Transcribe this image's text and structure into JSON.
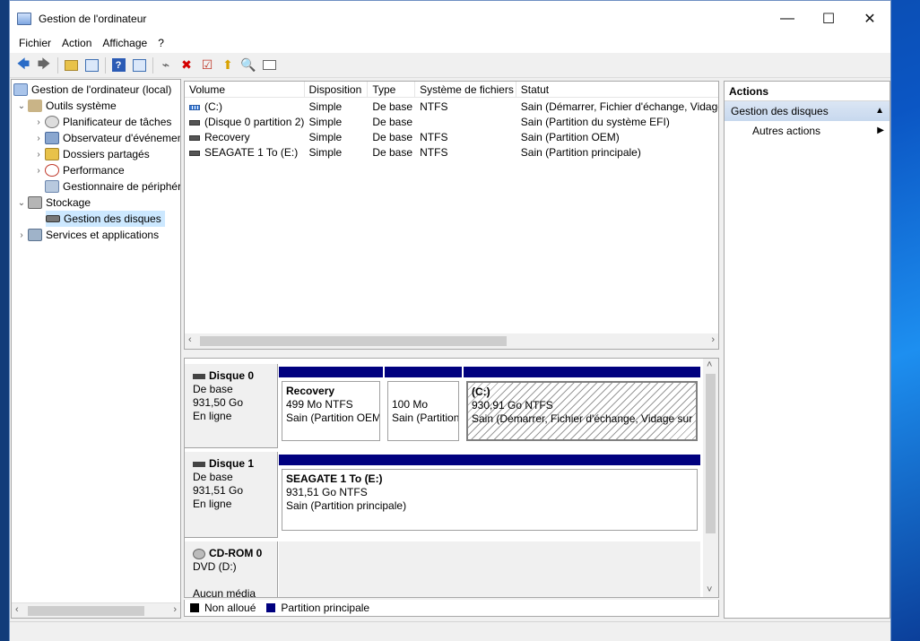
{
  "window": {
    "title": "Gestion de l'ordinateur",
    "controls": {
      "minimize": "—",
      "maximize": "☐",
      "close": "✕"
    }
  },
  "menu": [
    "Fichier",
    "Action",
    "Affichage",
    "?"
  ],
  "tree": {
    "root": "Gestion de l'ordinateur (local)",
    "items": [
      {
        "label": "Outils système",
        "level": 1,
        "expander": "⌄"
      },
      {
        "label": "Planificateur de tâches",
        "level": 2,
        "expander": "›"
      },
      {
        "label": "Observateur d'événements",
        "level": 2,
        "expander": "›"
      },
      {
        "label": "Dossiers partagés",
        "level": 2,
        "expander": "›"
      },
      {
        "label": "Performance",
        "level": 2,
        "expander": "›"
      },
      {
        "label": "Gestionnaire de périphériques",
        "level": 2,
        "expander": ""
      },
      {
        "label": "Stockage",
        "level": 1,
        "expander": "⌄"
      },
      {
        "label": "Gestion des disques",
        "level": 2,
        "expander": ""
      },
      {
        "label": "Services et applications",
        "level": 1,
        "expander": "›"
      }
    ]
  },
  "volumes": {
    "headers": [
      "Volume",
      "Disposition",
      "Type",
      "Système de fichiers",
      "Statut"
    ],
    "rows": [
      [
        "(C:)",
        "Simple",
        "De base",
        "NTFS",
        "Sain (Démarrer, Fichier d'échange, Vidage"
      ],
      [
        "(Disque 0 partition 2)",
        "Simple",
        "De base",
        "",
        "Sain (Partition du système EFI)"
      ],
      [
        "Recovery",
        "Simple",
        "De base",
        "NTFS",
        "Sain (Partition OEM)"
      ],
      [
        "SEAGATE 1 To (E:)",
        "Simple",
        "De base",
        "NTFS",
        "Sain (Partition principale)"
      ]
    ]
  },
  "disks": [
    {
      "name": "Disque 0",
      "type": "De base",
      "size": "931,50 Go",
      "state": "En ligne",
      "partitions": [
        {
          "name": "Recovery",
          "size": "499 Mo NTFS",
          "status": "Sain (Partition OEM)"
        },
        {
          "name": "",
          "size": "100 Mo",
          "status": "Sain (Partition du système EFI)"
        },
        {
          "name": "(C:)",
          "size": "930,91 Go NTFS",
          "status": "Sain (Démarrer, Fichier d'échange, Vidage sur incident)"
        }
      ]
    },
    {
      "name": "Disque 1",
      "type": "De base",
      "size": "931,51 Go",
      "state": "En ligne",
      "partitions": [
        {
          "name": "SEAGATE 1 To  (E:)",
          "size": "931,51 Go NTFS",
          "status": "Sain (Partition principale)"
        }
      ]
    },
    {
      "name": "CD-ROM 0",
      "type": "DVD (D:)",
      "state": "Aucun média"
    }
  ],
  "legend": [
    {
      "label": "Non alloué",
      "color": "#000000"
    },
    {
      "label": "Partition principale",
      "color": "#00007f"
    }
  ],
  "actions": {
    "title": "Actions",
    "section": "Gestion des disques",
    "items": [
      "Autres actions"
    ]
  }
}
